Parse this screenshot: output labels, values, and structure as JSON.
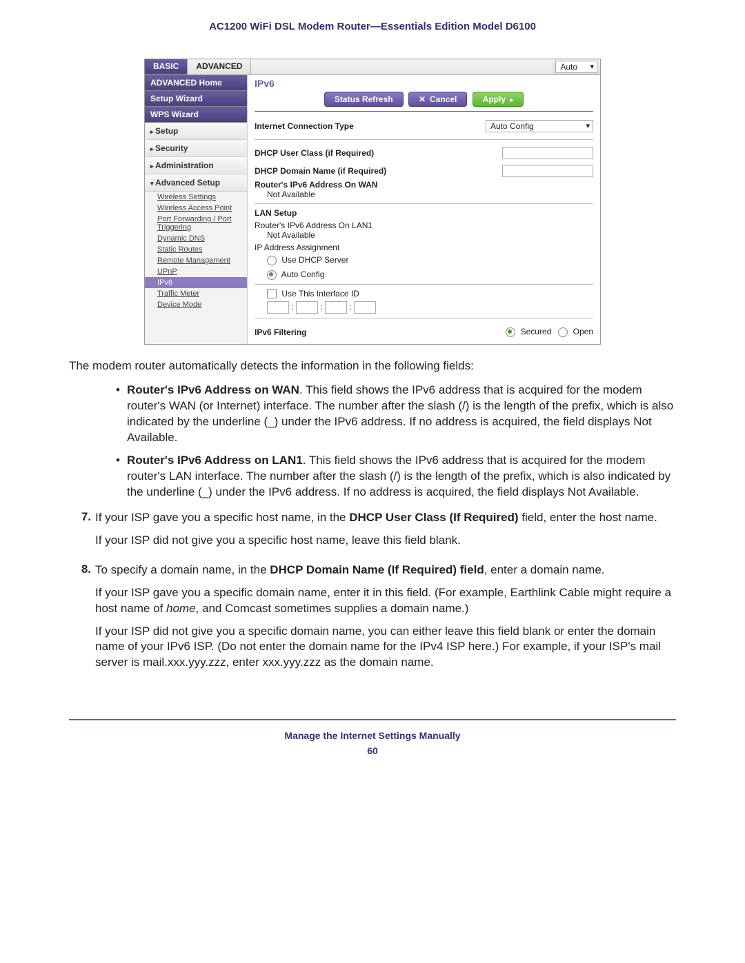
{
  "header": "AC1200 WiFi DSL Modem Router—Essentials Edition Model D6100",
  "shot": {
    "tab_basic": "BASIC",
    "tab_advanced": "ADVANCED",
    "auto_select": "Auto",
    "sidebar": {
      "adv_home": "ADVANCED Home",
      "setup_wizard": "Setup Wizard",
      "wps_wizard": "WPS Wizard",
      "setup": "Setup",
      "security": "Security",
      "administration": "Administration",
      "adv_setup": "Advanced Setup",
      "subs": {
        "wireless_settings": "Wireless Settings",
        "wap": "Wireless Access Point",
        "pf": "Port Forwarding / Port Triggering",
        "ddns": "Dynamic DNS",
        "static": "Static Routes",
        "remote": "Remote Management",
        "upnp": "UPnP",
        "ipv6": "IPv6",
        "traffic": "Traffic Meter",
        "device": "Device Mode"
      }
    },
    "content": {
      "title": "IPv6",
      "btn_status": "Status Refresh",
      "btn_cancel": "Cancel",
      "btn_apply": "Apply",
      "ict_label": "Internet Connection Type",
      "ict_value": "Auto Config",
      "dhcp_user_class": "DHCP User Class (if Required)",
      "dhcp_domain": "DHCP Domain Name  (if Required)",
      "wan_addr_label": "Router's IPv6 Address On WAN",
      "not_avail": "Not Available",
      "lan_setup": "LAN Setup",
      "lan1_addr_label": "Router's IPv6 Address On LAN1",
      "ip_assign": "IP Address Assignment",
      "use_dhcp": "Use DHCP Server",
      "auto_config": "Auto Config",
      "use_if_id": "Use This Interface ID",
      "ipv6_filtering": "IPv6 Filtering",
      "secured": "Secured",
      "open": "Open"
    }
  },
  "body": {
    "intro": "The modem router automatically detects the information in the following fields:",
    "bullets": [
      {
        "lead": "Router's IPv6 Address on WAN",
        "text": ". This field shows the IPv6 address that is acquired for the modem router's WAN (or Internet) interface. The number after the slash (/) is the length of the prefix, which is also indicated by the underline (_) under the IPv6 address. If no address is acquired, the field displays Not Available."
      },
      {
        "lead": "Router's IPv6 Address on LAN1",
        "text": ". This field shows the IPv6 address that is acquired for the modem router's LAN interface. The number after the slash (/) is the length of the prefix, which is also indicated by the underline (_) under the IPv6 address. If no address is acquired, the field displays Not Available."
      }
    ],
    "step7": {
      "num": "7.",
      "line1a": "If your ISP gave you a specific host name, in the ",
      "line1b": "DHCP User Class (If Required)",
      "line1c": " field, enter the host name.",
      "line2": "If your ISP did not give you a specific host name, leave this field blank."
    },
    "step8": {
      "num": "8.",
      "line1a": "To specify a domain name, in the ",
      "line1b": "DHCP Domain Name (If Required) field",
      "line1c": ", enter a domain name.",
      "line2a": "If your ISP gave you a specific domain name, enter it in this field. (For example, Earthlink Cable might require a host name of ",
      "line2b": "home",
      "line2c": ", and Comcast sometimes supplies a domain name.)",
      "line3": "If your ISP did not give you a specific domain name, you can either leave this field blank or enter the domain name of your IPv6 ISP. (Do not enter the domain name for the IPv4 ISP here.) For example, if your ISP's mail server is mail.xxx.yyy.zzz, enter xxx.yyy.zzz as the domain name."
    }
  },
  "footer": {
    "title": "Manage the Internet Settings Manually",
    "page": "60"
  }
}
